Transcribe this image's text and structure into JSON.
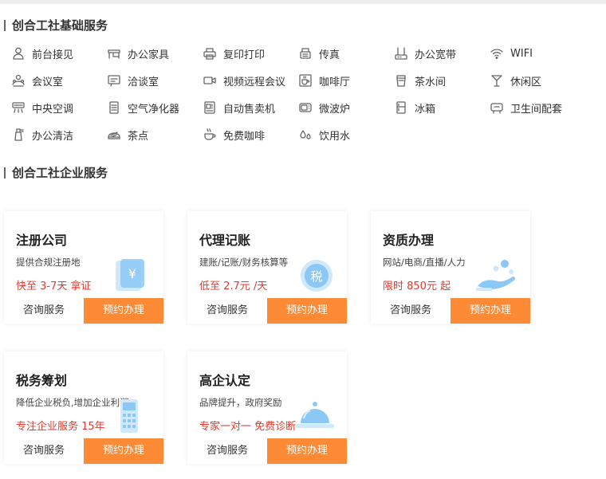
{
  "sections": {
    "basic_title": "创合工社基础服务",
    "enterprise_title": "创合工社企业服务"
  },
  "facilities": [
    {
      "label": "前台接见",
      "icon": "reception-icon"
    },
    {
      "label": "办公家具",
      "icon": "desk-icon"
    },
    {
      "label": "复印打印",
      "icon": "printer-icon"
    },
    {
      "label": "传真",
      "icon": "fax-icon"
    },
    {
      "label": "办公宽带",
      "icon": "router-icon"
    },
    {
      "label": "WIFI",
      "icon": "wifi-icon"
    },
    {
      "label": "会议室",
      "icon": "meeting-room-icon"
    },
    {
      "label": "洽谈室",
      "icon": "negotiation-room-icon"
    },
    {
      "label": "视频远程会议",
      "icon": "video-conference-icon"
    },
    {
      "label": "咖啡厅",
      "icon": "cafe-icon"
    },
    {
      "label": "茶水间",
      "icon": "tea-room-icon"
    },
    {
      "label": "休闲区",
      "icon": "lounge-icon"
    },
    {
      "label": "中央空调",
      "icon": "air-conditioner-icon"
    },
    {
      "label": "空气净化器",
      "icon": "air-purifier-icon"
    },
    {
      "label": "自动售卖机",
      "icon": "vending-machine-icon"
    },
    {
      "label": "微波炉",
      "icon": "microwave-icon"
    },
    {
      "label": "冰箱",
      "icon": "fridge-icon"
    },
    {
      "label": "卫生间配套",
      "icon": "restroom-icon"
    },
    {
      "label": "办公清洁",
      "icon": "cleaning-icon"
    },
    {
      "label": "茶点",
      "icon": "snack-icon"
    },
    {
      "label": "免费咖啡",
      "icon": "coffee-icon"
    },
    {
      "label": "饮用水",
      "icon": "water-icon"
    }
  ],
  "services": [
    {
      "title": "注册公司",
      "desc": "提供合规注册地",
      "price": "快至 3-7天 拿证",
      "consult": "咨询服务",
      "book": "预约办理",
      "icon": "yuan-card-icon"
    },
    {
      "title": "代理记账",
      "desc": "建账/记账/财务核算等",
      "price": "低至 2.7元 /天",
      "consult": "咨询服务",
      "book": "预约办理",
      "icon": "tax-coin-icon"
    },
    {
      "title": "资质办理",
      "desc": "网站/电商/直播/人力",
      "price": "限时 850元 起",
      "consult": "咨询服务",
      "book": "预约办理",
      "icon": "hand-coins-icon"
    },
    {
      "title": "税务筹划",
      "desc": "降低企业税负,增加企业利润",
      "price": "专注企业服务 15年",
      "consult": "咨询服务",
      "book": "预约办理",
      "icon": "pos-machine-icon"
    },
    {
      "title": "高企认定",
      "desc": "品牌提升，政府奖励",
      "price": "专家一对一 免费诊断",
      "consult": "咨询服务",
      "book": "预约办理",
      "icon": "service-bell-icon"
    }
  ],
  "colors": {
    "accent": "#fd8a34",
    "price": "#e03b30",
    "illustration": "#8cc8f5"
  }
}
